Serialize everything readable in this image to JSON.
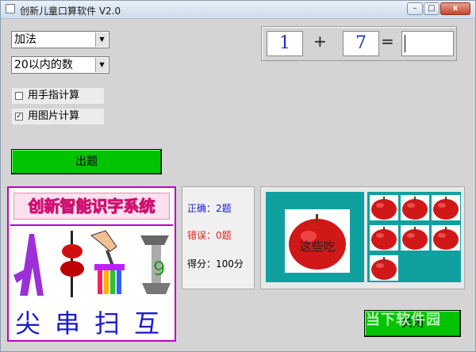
{
  "window": {
    "title": "创新儿童口算软件 V2.0"
  },
  "titlebar_buttons": {
    "minimize": "–",
    "maximize": "□",
    "close": "x"
  },
  "controls": {
    "operation": {
      "selected": "加法"
    },
    "range": {
      "selected": "20以内的数"
    },
    "checkboxes": [
      {
        "label": "用手指计算",
        "checked": false,
        "mark": ""
      },
      {
        "label": "用图片计算",
        "checked": true,
        "mark": "✓"
      }
    ],
    "start_button": "出题"
  },
  "equation": {
    "operand1": "1",
    "operator": "+",
    "operand2": "7",
    "equals": "=",
    "answer": ""
  },
  "left_panel": {
    "logo_text": "创新智能识字系统",
    "characters": [
      "尖",
      "串",
      "扫",
      "互"
    ]
  },
  "stats": {
    "correct": "正确：2题",
    "wrong": "错误：0题",
    "score": "得分：100分"
  },
  "picture_panel": {
    "big_apple_caption": "这些吃",
    "small_apple_count": 7
  },
  "close_button": "关闭",
  "watermark": "当下软件园",
  "colors": {
    "button_green": "#00c400",
    "teal": "#10a0a0",
    "number_blue": "#1a2fbf",
    "correct_blue": "#1a1acc",
    "wrong_red": "#e02020",
    "logo_magenta": "#c000c0"
  }
}
